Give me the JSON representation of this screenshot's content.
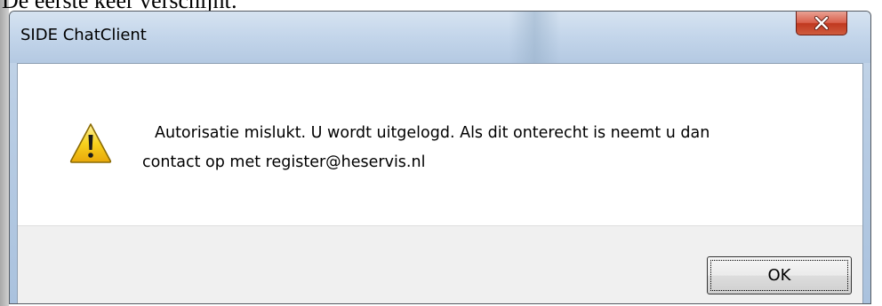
{
  "background_text": "De eerste keer verschijnt:",
  "dialog": {
    "title": "SIDE ChatClient",
    "close_icon": "close-icon",
    "warning_icon": "warning-icon",
    "message_line1": "Autorisatie mislukt. U wordt uitgelogd. Als dit onterecht is neemt u dan",
    "message_line2": "contact op met register@heservis.nl",
    "ok_label": "OK"
  },
  "colors": {
    "close_button": "#c8442c",
    "title_bar": "#c3d5ea",
    "warning_yellow": "#f7d21e"
  }
}
